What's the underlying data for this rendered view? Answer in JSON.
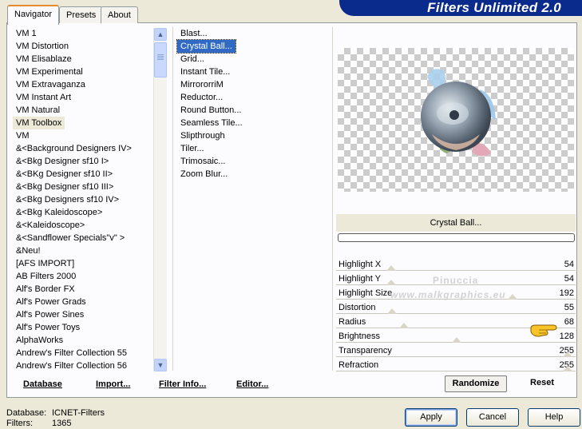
{
  "app": {
    "title": "Filters Unlimited 2.0"
  },
  "tabs": [
    {
      "label": "Navigator",
      "active": true
    },
    {
      "label": "Presets",
      "active": false
    },
    {
      "label": "About",
      "active": false
    }
  ],
  "categories": [
    "VM 1",
    "VM Distortion",
    "VM Elisablaze",
    "VM Experimental",
    "VM Extravaganza",
    "VM Instant Art",
    "VM Natural",
    "VM Toolbox",
    "VM",
    "&<Background Designers IV>",
    "&<Bkg Designer sf10 I>",
    "&<BKg Designer sf10 II>",
    "&<Bkg Designer sf10 III>",
    "&<Bkg Designers sf10 IV>",
    "&<Bkg Kaleidoscope>",
    "&<Kaleidoscope>",
    "&<Sandflower Specials\"v\" >",
    "&Neu!",
    "[AFS IMPORT]",
    "AB Filters 2000",
    "Alf's Border FX",
    "Alf's Power Grads",
    "Alf's Power Sines",
    "Alf's Power Toys",
    "AlphaWorks",
    "Andrew's Filter Collection 55",
    "Andrew's Filter Collection 56"
  ],
  "selected_category": "VM Toolbox",
  "filters": [
    "Blast...",
    "Crystal Ball...",
    "Grid...",
    "Instant Tile...",
    "MirrororriM",
    "Reductor...",
    "Round Button...",
    "Seamless Tile...",
    "Slipthrough",
    "Tiler...",
    "Trimosaic...",
    "Zoom Blur..."
  ],
  "selected_filter": "Crystal Ball...",
  "preview": {
    "filter_title": "Crystal Ball..."
  },
  "sliders": [
    {
      "label": "Highlight X",
      "value": "54",
      "fraction": 0.212
    },
    {
      "label": "Highlight Y",
      "value": "54",
      "fraction": 0.212
    },
    {
      "label": "Highlight Size",
      "value": "192",
      "fraction": 0.753
    },
    {
      "label": "Distortion",
      "value": "55",
      "fraction": 0.216
    },
    {
      "label": "Radius",
      "value": "68",
      "fraction": 0.267
    },
    {
      "label": "Brightness",
      "value": "128",
      "fraction": 0.502
    },
    {
      "label": "Transparency",
      "value": "255",
      "fraction": 1.0
    },
    {
      "label": "Refraction",
      "value": "255",
      "fraction": 1.0
    }
  ],
  "toolbar": {
    "database": "Database",
    "import": "Import...",
    "filter_info": "Filter Info...",
    "editor": "Editor...",
    "randomize": "Randomize",
    "reset": "Reset"
  },
  "watermark": {
    "line1": "Pinuccia",
    "line2": "www.malkgraphics.eu"
  },
  "footer": {
    "database_label": "Database:",
    "database_value": "ICNET-Filters",
    "filters_label": "Filters:",
    "filters_value": "1365",
    "apply": "Apply",
    "cancel": "Cancel",
    "help": "Help"
  },
  "colors": {
    "banner": "#0a2a8c",
    "selection": "#316ac5",
    "face": "#ece9d8"
  }
}
